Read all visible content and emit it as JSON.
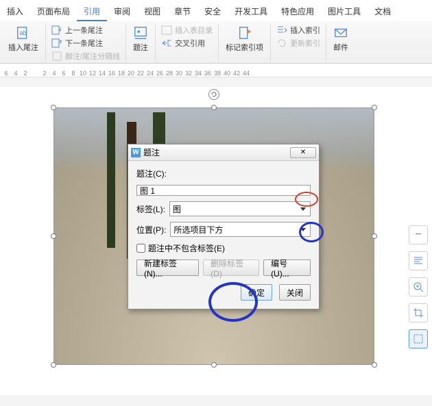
{
  "tabs": [
    "插入",
    "页面布局",
    "引用",
    "审阅",
    "视图",
    "章节",
    "安全",
    "开发工具",
    "特色应用",
    "图片工具",
    "文档"
  ],
  "active_tab_index": 2,
  "toolbar": {
    "insert_footnote": "插入尾注",
    "prev_endnote": "上一条尾注",
    "next_endnote": "下一条尾注",
    "foot_end_sep": "脚注/尾注分隔线",
    "caption": "题注",
    "insert_toc": "插入表目录",
    "cross_ref": "交叉引用",
    "mark_index": "标记索引项",
    "insert_index": "插入索引",
    "update_index": "更新索引",
    "mail": "邮件"
  },
  "ruler": [
    "6",
    "4",
    "2",
    "",
    "2",
    "4",
    "6",
    "8",
    "10",
    "12",
    "14",
    "16",
    "18",
    "20",
    "22",
    "24",
    "26",
    "28",
    "30",
    "32",
    "34",
    "36",
    "38",
    "40",
    "42",
    "44"
  ],
  "dialog": {
    "title": "题注",
    "caption_label": "题注(C):",
    "caption_value": "图 1",
    "label_label": "标签(L):",
    "label_value": "图",
    "position_label": "位置(P):",
    "position_value": "所选项目下方",
    "exclude_label": "题注中不包含标签(E)",
    "new_label_btn": "新建标签(N)...",
    "delete_label_btn": "删除标签(D)",
    "numbering_btn": "编号(U)...",
    "ok_btn": "确定",
    "close_btn": "关闭"
  }
}
